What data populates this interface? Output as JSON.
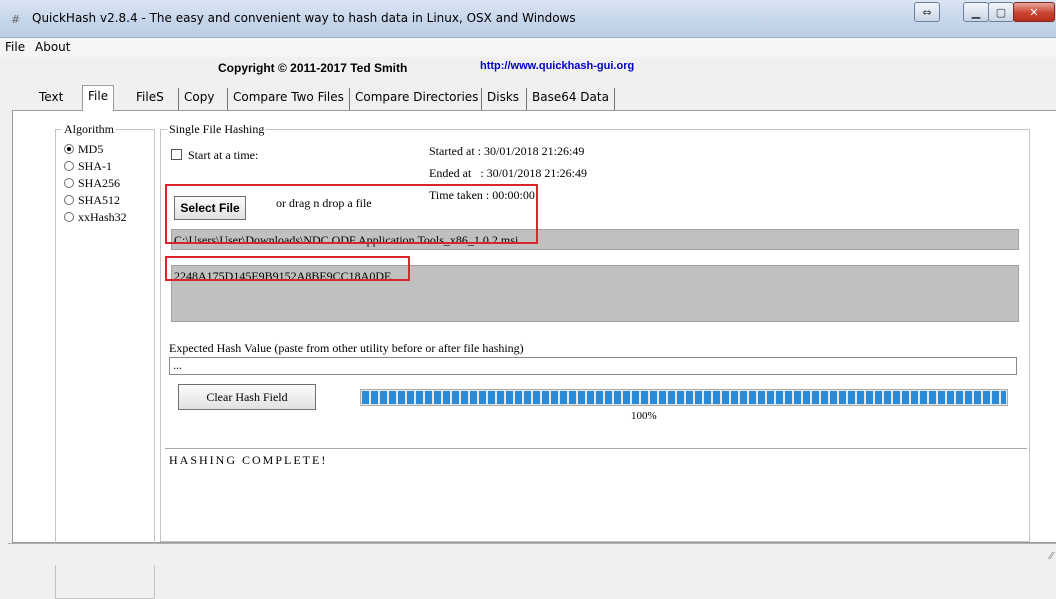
{
  "window": {
    "title": "QuickHash v2.8.4 - The easy and convenient way to hash data in Linux, OSX and Windows",
    "app_icon": "#"
  },
  "menu": {
    "items": [
      "File",
      "About"
    ]
  },
  "header": {
    "copyright": "Copyright © 2011-2017  Ted Smith",
    "url": "http://www.quickhash-gui.org"
  },
  "tabs": [
    {
      "label": "Text"
    },
    {
      "label": "File",
      "active": true
    },
    {
      "label": "FileS"
    },
    {
      "label": "Copy"
    },
    {
      "label": "Compare Two Files"
    },
    {
      "label": "Compare Directories"
    },
    {
      "label": "Disks"
    },
    {
      "label": "Base64 Data"
    }
  ],
  "algorithm": {
    "legend": "Algorithm",
    "options": [
      "MD5",
      "SHA-1",
      "SHA256",
      "SHA512",
      "xxHash32"
    ],
    "selected": "MD5"
  },
  "single_file": {
    "legend": "Single File Hashing",
    "start_at_time_label": "Start at a time:",
    "start_at_time_checked": false,
    "started_at": "Started at : 30/01/2018 21:26:49",
    "ended_at": "Ended at   : 30/01/2018 21:26:49",
    "time_taken": "Time taken : 00:00:00",
    "select_file_label": "Select File",
    "drag_drop_label": "or drag n drop a file",
    "file_path": "C:\\Users\\User\\Downloads\\NDC ODF Application Tools_x86_1.0.2.msi",
    "hash_value": "2248A175D145E9B9152A8BE9CC18A0DE",
    "expected_label": "Expected Hash Value (paste from other utility before or after file hashing)",
    "expected_value": "...",
    "clear_hash_label": "Clear Hash Field",
    "progress_percent": 100,
    "progress_label": "100%",
    "status": "HASHING COMPLETE!"
  },
  "colors": {
    "highlight": "#d9262c",
    "progress": "#2a8cd8",
    "url": "#0000c8"
  }
}
